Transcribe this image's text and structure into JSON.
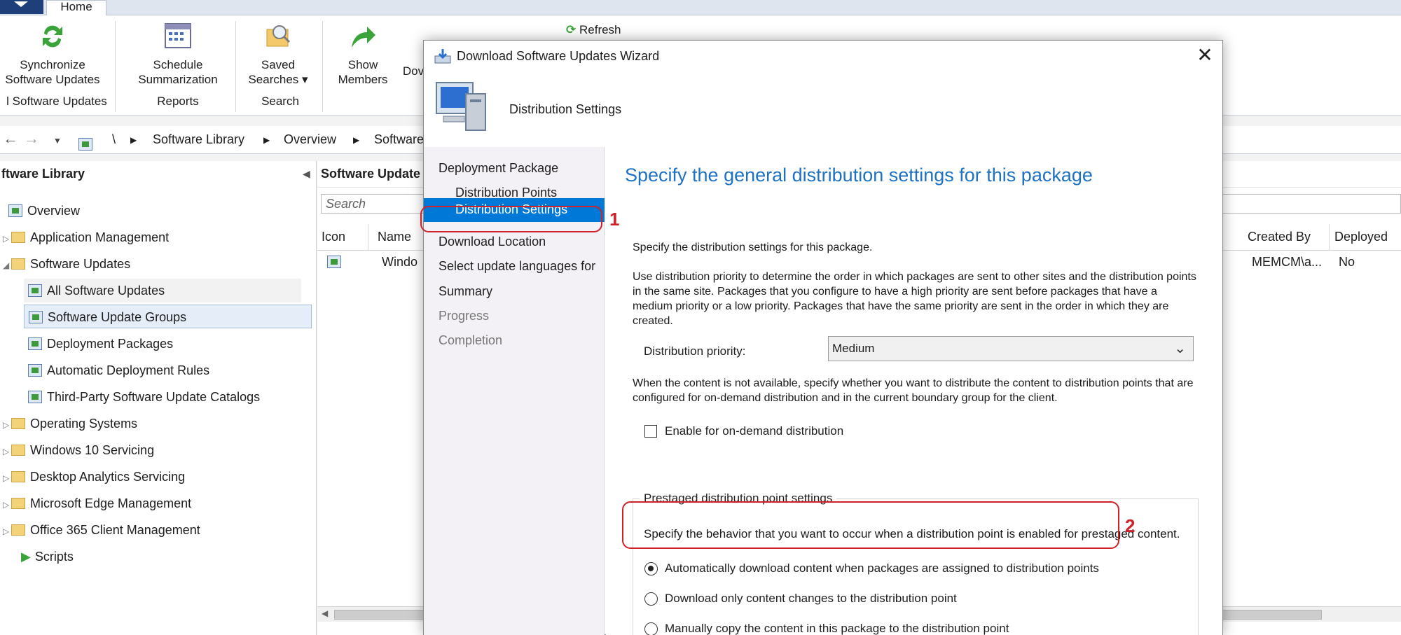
{
  "tabs": {
    "home": "Home"
  },
  "ribbon": {
    "buttons": {
      "synchronize": "Synchronize\nSoftware Updates",
      "schedule": "Schedule\nSummarization",
      "saved_searches": "Saved\nSearches ▾",
      "show_members": "Show\nMembers",
      "download_partial": "Dov",
      "refresh": "Refresh"
    },
    "groups": {
      "all_updates": "l Software Updates",
      "reports": "Reports",
      "search": "Search"
    }
  },
  "breadcrumb": {
    "root": "\\",
    "items": [
      "Software Library",
      "Overview",
      "Software"
    ]
  },
  "nav": {
    "header": "ftware Library",
    "items": [
      "Overview",
      "Application Management",
      "Software Updates",
      "All Software Updates",
      "Software Update Groups",
      "Deployment Packages",
      "Automatic Deployment Rules",
      "Third-Party Software Update Catalogs",
      "Operating Systems",
      "Windows 10 Servicing",
      "Desktop Analytics Servicing",
      "Microsoft Edge Management",
      "Office 365 Client Management",
      "Scripts"
    ]
  },
  "content": {
    "header": "Software Update",
    "search_placeholder": "Search",
    "columns": {
      "icon": "Icon",
      "name": "Name",
      "created_by": "Created By",
      "deployed": "Deployed"
    },
    "row": {
      "name": "Windo",
      "created_by": "MEMCM\\a...",
      "deployed": "No"
    }
  },
  "wizard": {
    "title": "Download Software Updates Wizard",
    "close": "✕",
    "banner_title": "Distribution Settings",
    "steps": [
      "Deployment Package",
      "Distribution Points",
      "Distribution Settings",
      "Download Location",
      "Select update languages for",
      "Summary",
      "Progress",
      "Completion"
    ],
    "heading": "Specify the general distribution settings for this package",
    "intro": "Specify the distribution settings for this package.",
    "priority_help": "Use distribution priority to determine the order in which packages are sent to other sites and the distribution points in the same site. Packages that you configure to have a high priority are sent before packages that have a medium priority or a low priority. Packages that have the same priority are sent in the order in which they are created.",
    "priority_label": "Distribution priority:",
    "priority_value": "Medium",
    "ondemand_help": "When the content is not available, specify whether you want to distribute the content to distribution points that are configured for on-demand distribution and in the current boundary group for the client.",
    "ondemand_checkbox": "Enable for on-demand distribution",
    "prestage_legend": "Prestaged distribution point settings",
    "prestage_help": "Specify the behavior that you want to occur when a distribution point is enabled for prestaged content.",
    "options": [
      "Automatically download content when packages are assigned to distribution points",
      "Download only content changes to the distribution point",
      "Manually copy the content in this package to the distribution point"
    ]
  },
  "annotations": {
    "one": "1",
    "two": "2"
  },
  "colors": {
    "accent": "#0078d7",
    "heading": "#1e72c2",
    "callout": "#d0202a"
  }
}
